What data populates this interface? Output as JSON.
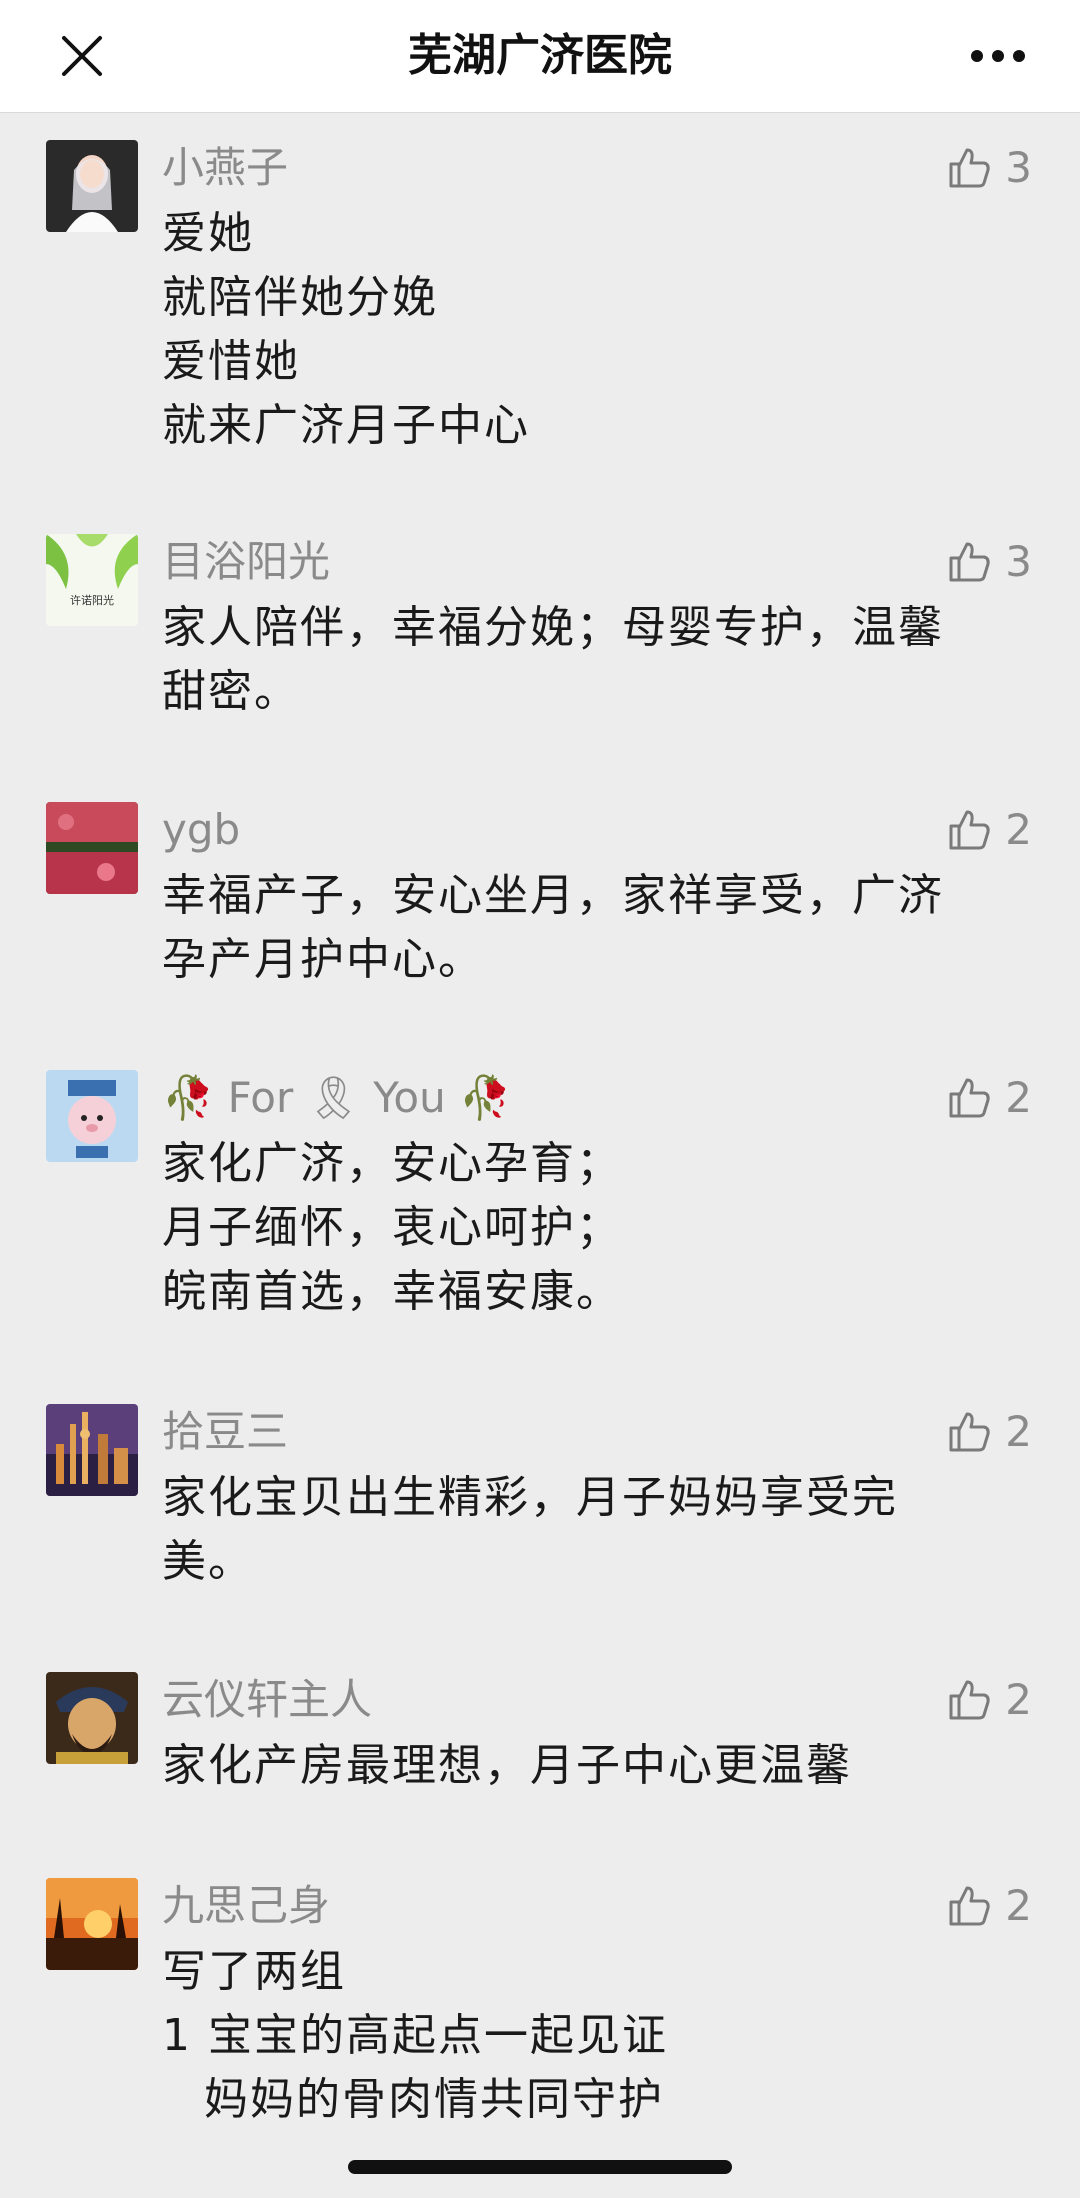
{
  "header": {
    "title": "芜湖广济医院",
    "close_icon": "close-icon",
    "more_icon": "more-icon"
  },
  "comments": [
    {
      "name": "小燕子",
      "likes": "3",
      "lines": [
        "爱她",
        "就陪伴她分娩",
        "爱惜她",
        "就来广济月子中心"
      ],
      "avatar_icon": "bride-avatar"
    },
    {
      "name": "目浴阳光",
      "likes": "3",
      "lines": [
        "家人陪伴，幸福分娩；母婴专护，温馨",
        "甜密。"
      ],
      "avatar_icon": "leaf-avatar",
      "avatar_text": "许诺阳光"
    },
    {
      "name": "ygb",
      "likes": "2",
      "lines": [
        "幸福产子，安心坐月，家祥享受，广济",
        "孕产月护中心。"
      ],
      "avatar_icon": "flowers-avatar"
    },
    {
      "name": "🥀 For 🎗 You 🥀",
      "likes": "2",
      "lines": [
        "家化广济，安心孕育；",
        "月子缅怀，衷心呵护；",
        "皖南首选，幸福安康。"
      ],
      "avatar_icon": "cartoon-avatar"
    },
    {
      "name": "拾豆三",
      "likes": "2",
      "lines": [
        "家化宝贝出生精彩，月子妈妈享受完",
        "美。"
      ],
      "avatar_icon": "city-avatar"
    },
    {
      "name": "云仪轩主人",
      "likes": "2",
      "lines": [
        "家化产房最理想，月子中心更温馨"
      ],
      "avatar_icon": "portrait-avatar"
    },
    {
      "name": "九思己身",
      "likes": "2",
      "lines": [
        "写了两组",
        "1  宝宝的高起点一起见证",
        "妈妈的骨肉情共同守护"
      ],
      "avatar_icon": "sunset-avatar"
    }
  ],
  "colors": {
    "background": "#ededed",
    "header_bg": "#ffffff",
    "nickname": "#8a8a8a",
    "text": "#1a1a1a"
  }
}
